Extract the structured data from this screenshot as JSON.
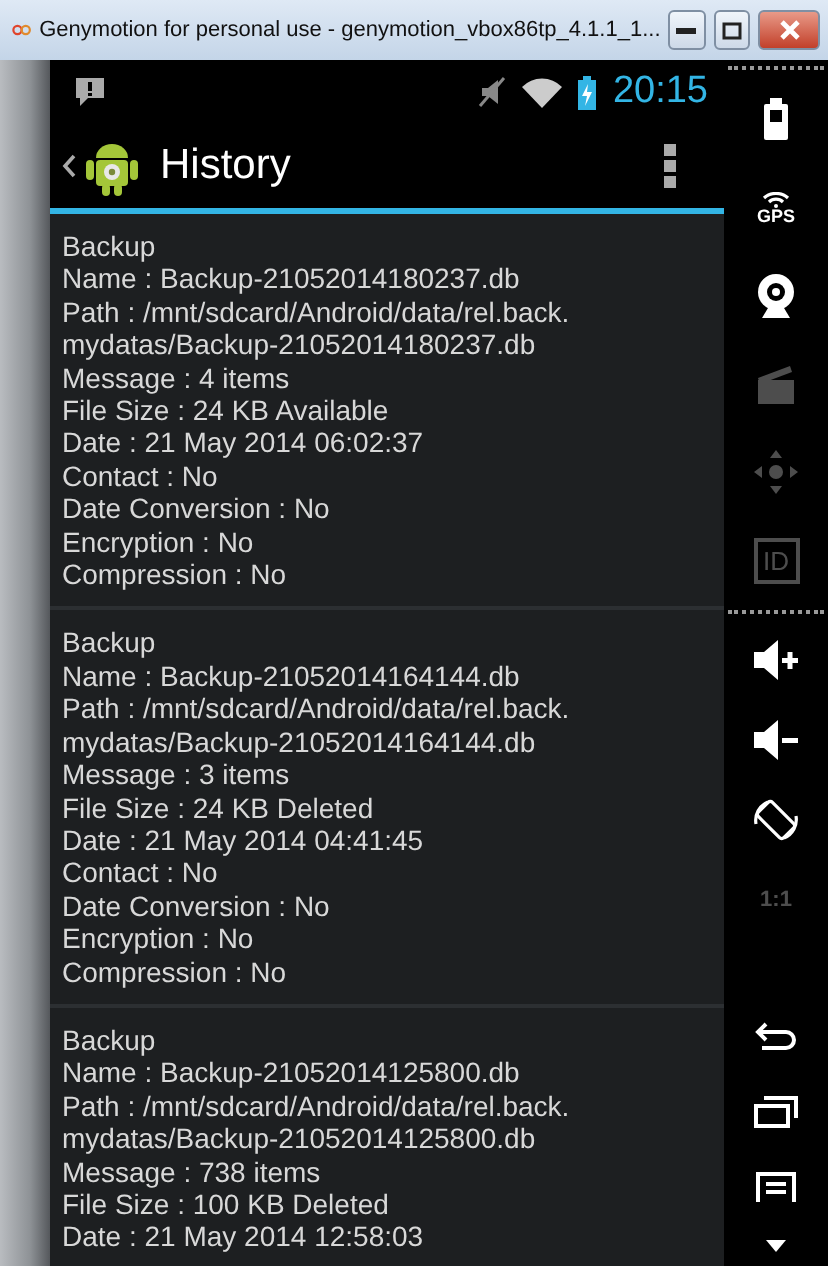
{
  "window": {
    "title": "Genymotion for personal use - genymotion_vbox86tp_4.1.1_1..."
  },
  "status_bar": {
    "time": "20:15"
  },
  "action_bar": {
    "title": "History"
  },
  "backups": [
    {
      "heading": "Backup",
      "lines": [
        "Name : Backup-21052014180237.db",
        "Path : /mnt/sdcard/Android/data/rel.back.",
        "mydatas/Backup-21052014180237.db",
        "Message : 4 items",
        "File Size : 24 KB Available",
        "Date : 21 May 2014 06:02:37",
        "Contact : No",
        "Date Conversion : No",
        "Encryption : No",
        "Compression : No"
      ]
    },
    {
      "heading": "Backup",
      "lines": [
        "Name : Backup-21052014164144.db",
        "Path : /mnt/sdcard/Android/data/rel.back.",
        "mydatas/Backup-21052014164144.db",
        "Message : 3 items",
        "File Size : 24 KB Deleted",
        "Date : 21 May 2014 04:41:45",
        "Contact : No",
        "Date Conversion : No",
        "Encryption : No",
        "Compression : No"
      ]
    },
    {
      "heading": "Backup",
      "lines": [
        "Name : Backup-21052014125800.db",
        "Path : /mnt/sdcard/Android/data/rel.back.",
        "mydatas/Backup-21052014125800.db",
        "Message : 738 items",
        "File Size : 100 KB Deleted",
        "Date : 21 May 2014 12:58:03"
      ]
    }
  ],
  "emulator_sidebar": {
    "top": [
      {
        "kind": "battery",
        "disabled": false
      },
      {
        "kind": "gps",
        "label": "GPS",
        "disabled": false
      },
      {
        "kind": "webcam",
        "disabled": false
      },
      {
        "kind": "clapper",
        "disabled": true
      },
      {
        "kind": "dpad",
        "disabled": true
      },
      {
        "kind": "id",
        "label": "ID",
        "disabled": true
      }
    ],
    "middle": [
      {
        "kind": "volume_up",
        "disabled": false
      },
      {
        "kind": "volume_down",
        "disabled": false
      },
      {
        "kind": "rotate",
        "disabled": false
      },
      {
        "kind": "scale",
        "label": "1:1",
        "disabled": true
      }
    ],
    "bottom": [
      {
        "kind": "back",
        "disabled": false
      },
      {
        "kind": "recent",
        "disabled": false
      },
      {
        "kind": "menu",
        "disabled": false
      },
      {
        "kind": "more",
        "disabled": false
      }
    ]
  }
}
